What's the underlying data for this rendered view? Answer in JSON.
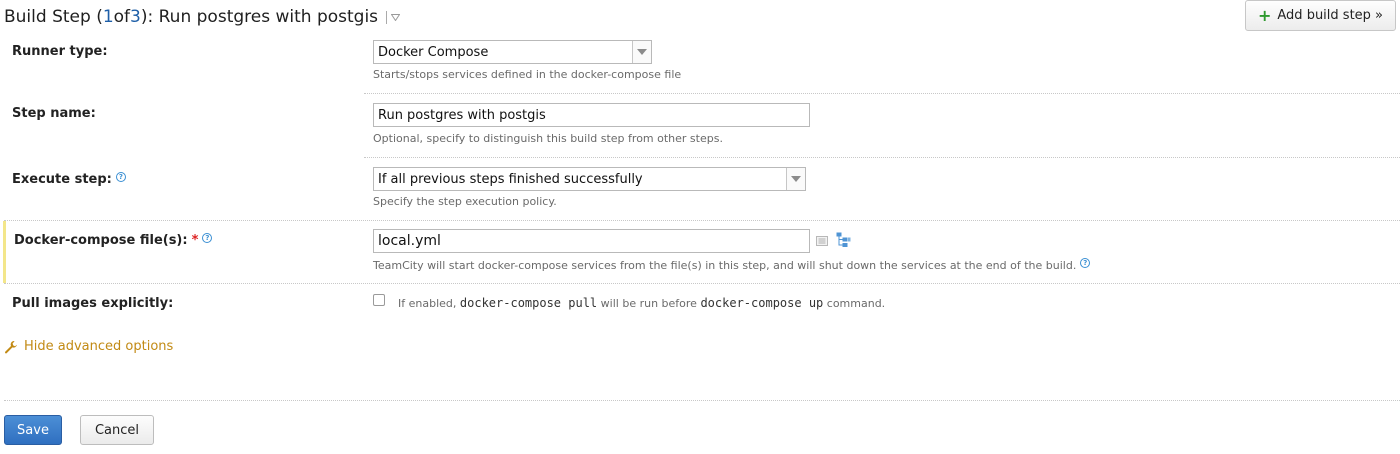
{
  "header": {
    "prefix": "Build Step (",
    "current": "1",
    "of": " of ",
    "total": "3",
    "suffix": "): Run postgres with postgis",
    "add_button": "Add build step »"
  },
  "runner": {
    "label": "Runner type:",
    "value": "Docker Compose",
    "hint": "Starts/stops services defined in the docker-compose file"
  },
  "step_name": {
    "label": "Step name:",
    "value": "Run postgres with postgis",
    "hint": "Optional, specify to distinguish this build step from other steps."
  },
  "execute": {
    "label": "Execute step:",
    "value": "If all previous steps finished successfully",
    "hint": "Specify the step execution policy."
  },
  "compose_files": {
    "label": "Docker-compose file(s):",
    "required_mark": "*",
    "value": "local.yml",
    "hint": "TeamCity will start docker-compose services from the file(s) in this step, and will shut down the services at the end of the build."
  },
  "pull_images": {
    "label": "Pull images explicitly:",
    "checked": false,
    "hint_pre": "If enabled,",
    "hint_cmd1": "docker-compose pull",
    "hint_mid": "will be run before",
    "hint_cmd2": "docker-compose up",
    "hint_post": "command."
  },
  "advanced": {
    "label": "Hide advanced options"
  },
  "actions": {
    "save": "Save",
    "cancel": "Cancel"
  },
  "colors": {
    "accent": "#2f6fc0",
    "link": "#c28a14",
    "required": "#dd2222",
    "highlight": "#f3e68a"
  }
}
